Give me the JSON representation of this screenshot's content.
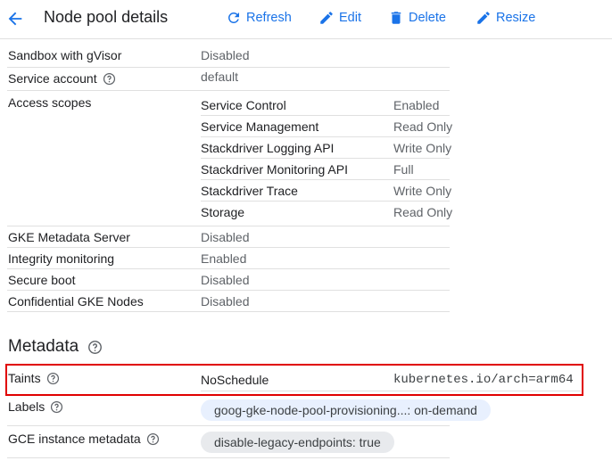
{
  "header": {
    "title": "Node pool details",
    "refresh_label": "Refresh",
    "edit_label": "Edit",
    "delete_label": "Delete",
    "resize_label": "Resize"
  },
  "security": {
    "sandbox": {
      "label": "Sandbox with gVisor",
      "value": "Disabled"
    },
    "service_account": {
      "label": "Service account",
      "value": "default"
    },
    "access_scopes": {
      "label": "Access scopes",
      "scopes": [
        {
          "name": "Service Control",
          "value": "Enabled"
        },
        {
          "name": "Service Management",
          "value": "Read Only"
        },
        {
          "name": "Stackdriver Logging API",
          "value": "Write Only"
        },
        {
          "name": "Stackdriver Monitoring API",
          "value": "Full"
        },
        {
          "name": "Stackdriver Trace",
          "value": "Write Only"
        },
        {
          "name": "Storage",
          "value": "Read Only"
        }
      ]
    },
    "gke_metadata_server": {
      "label": "GKE Metadata Server",
      "value": "Disabled"
    },
    "integrity_monitoring": {
      "label": "Integrity monitoring",
      "value": "Enabled"
    },
    "secure_boot": {
      "label": "Secure boot",
      "value": "Disabled"
    },
    "confidential_nodes": {
      "label": "Confidential GKE Nodes",
      "value": "Disabled"
    }
  },
  "metadata": {
    "title": "Metadata",
    "taints": {
      "label": "Taints",
      "effect": "NoSchedule",
      "value": "kubernetes.io/arch=arm64"
    },
    "labels": {
      "label": "Labels",
      "chip": "goog-gke-node-pool-provisioning...: on-demand"
    },
    "gce_instance_metadata": {
      "label": "GCE instance metadata",
      "chip": "disable-legacy-endpoints: true"
    }
  },
  "colors": {
    "accent": "#1a73e8",
    "highlight": "#e00000"
  }
}
